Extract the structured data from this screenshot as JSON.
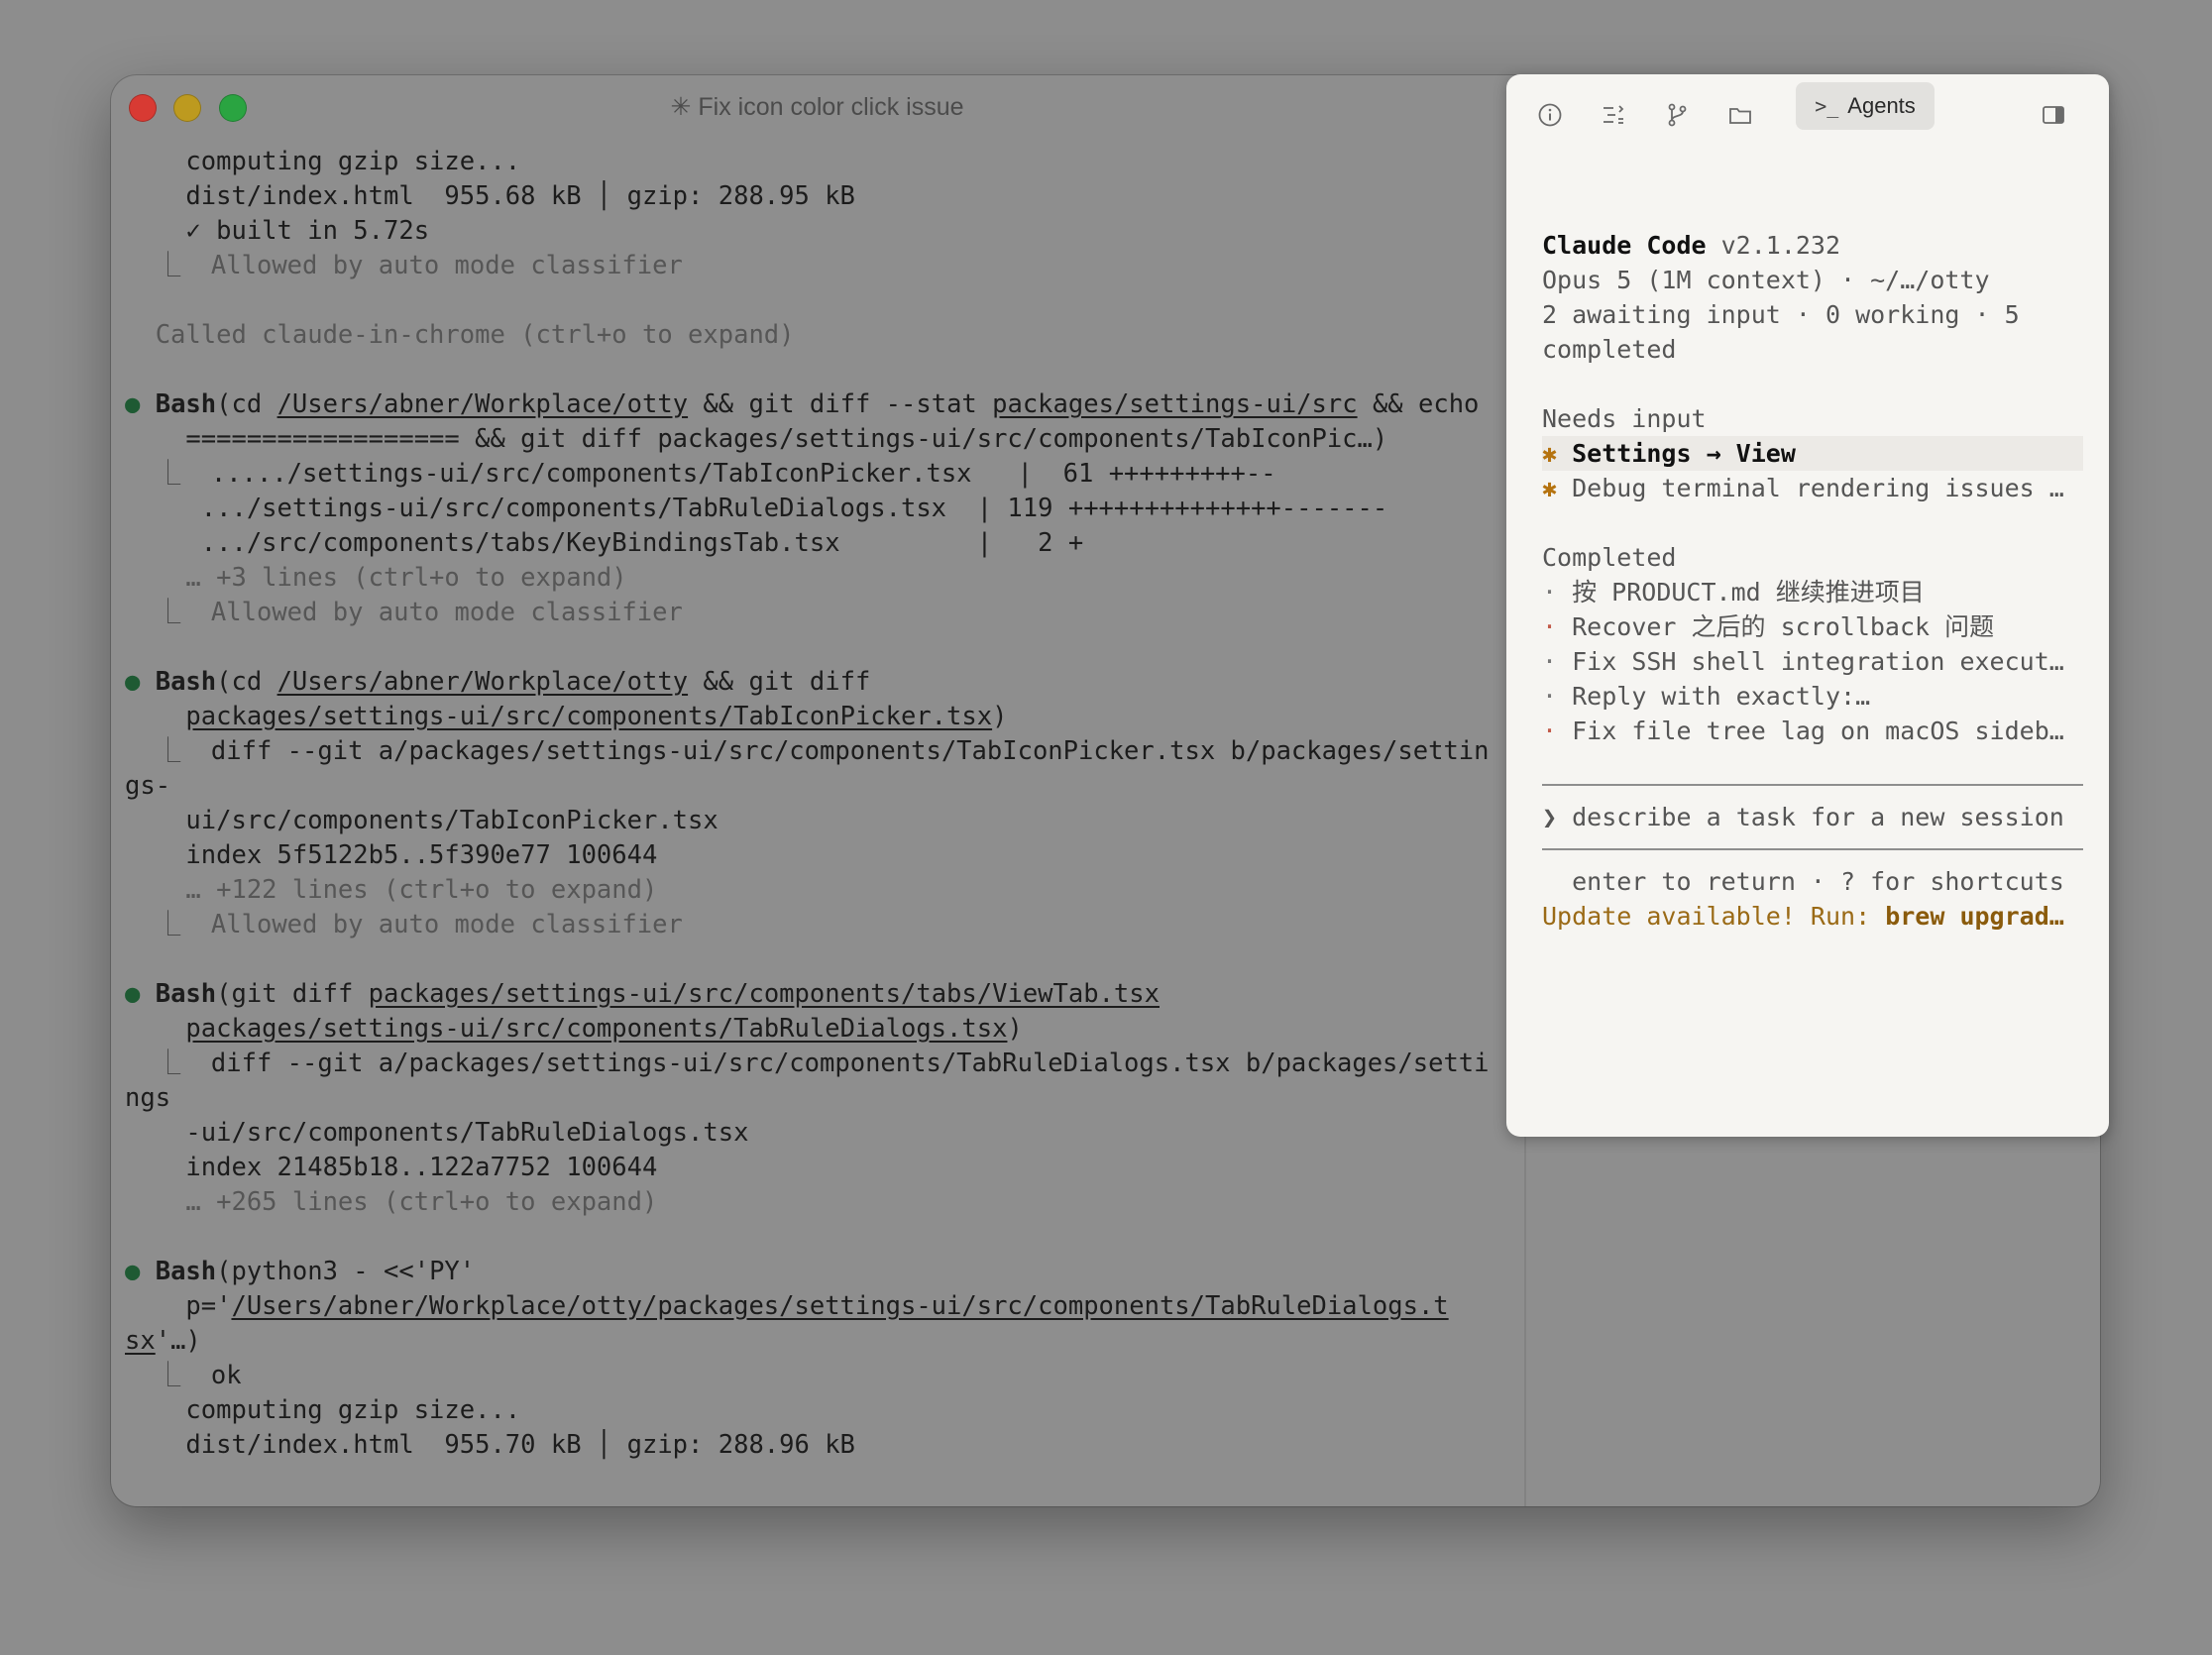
{
  "window": {
    "title": "✳ Fix icon color click issue"
  },
  "terminal": {
    "lines": [
      {
        "k": "out",
        "t": "    computing gzip size..."
      },
      {
        "k": "out",
        "t": "    dist/index.html  955.68 kB │ gzip: 288.95 kB"
      },
      {
        "k": "out",
        "t": "    ✓ built in 5.72s"
      },
      {
        "k": "allow",
        "t": "Allowed by auto mode classifier"
      },
      {
        "k": "blank"
      },
      {
        "k": "info",
        "t": "  Called claude-in-chrome (ctrl+o to expand)"
      },
      {
        "k": "blank"
      },
      {
        "k": "cmd",
        "tool": "Bash",
        "segs": [
          {
            "t": "(cd "
          },
          {
            "t": "/Users/abner/Workplace/otty",
            "u": true
          },
          {
            "t": " && git diff --stat "
          },
          {
            "t": "packages/settings-ui/src",
            "u": true
          },
          {
            "t": " && echo"
          }
        ]
      },
      {
        "k": "cont",
        "t": "    ================== && git diff packages/settings-ui/src/components/TabIconPic…)"
      },
      {
        "k": "res",
        "t": "...../settings-ui/src/components/TabIconPicker.tsx   |  61 +++++++++--"
      },
      {
        "k": "out",
        "t": "     .../settings-ui/src/components/TabRuleDialogs.tsx  | 119 ++++++++++++++-------"
      },
      {
        "k": "out",
        "t": "     .../src/components/tabs/KeyBindingsTab.tsx         |   2 +"
      },
      {
        "k": "dim",
        "t": "    … +3 lines (ctrl+o to expand)"
      },
      {
        "k": "allow",
        "t": "Allowed by auto mode classifier"
      },
      {
        "k": "blank"
      },
      {
        "k": "cmd",
        "tool": "Bash",
        "segs": [
          {
            "t": "(cd "
          },
          {
            "t": "/Users/abner/Workplace/otty",
            "u": true
          },
          {
            "t": " && git diff"
          }
        ]
      },
      {
        "k": "contseg",
        "segs": [
          {
            "t": "    "
          },
          {
            "t": "packages/settings-ui/src/components/TabIconPicker.tsx",
            "u": true
          },
          {
            "t": ")"
          }
        ]
      },
      {
        "k": "res",
        "t": "diff --git a/packages/settings-ui/src/components/TabIconPicker.tsx b/packages/settin"
      },
      {
        "k": "out",
        "t": "gs-"
      },
      {
        "k": "out",
        "t": "    ui/src/components/TabIconPicker.tsx"
      },
      {
        "k": "out",
        "t": "    index 5f5122b5..5f390e77 100644"
      },
      {
        "k": "dim",
        "t": "    … +122 lines (ctrl+o to expand)"
      },
      {
        "k": "allow",
        "t": "Allowed by auto mode classifier"
      },
      {
        "k": "blank"
      },
      {
        "k": "cmd",
        "tool": "Bash",
        "segs": [
          {
            "t": "(git diff "
          },
          {
            "t": "packages/settings-ui/src/components/tabs/ViewTab.tsx",
            "u": true
          }
        ]
      },
      {
        "k": "contseg",
        "segs": [
          {
            "t": "    "
          },
          {
            "t": "packages/settings-ui/src/components/TabRuleDialogs.tsx",
            "u": true
          },
          {
            "t": ")"
          }
        ]
      },
      {
        "k": "res",
        "t": "diff --git a/packages/settings-ui/src/components/TabRuleDialogs.tsx b/packages/setti"
      },
      {
        "k": "out",
        "t": "ngs"
      },
      {
        "k": "out",
        "t": "    -ui/src/components/TabRuleDialogs.tsx"
      },
      {
        "k": "out",
        "t": "    index 21485b18..122a7752 100644"
      },
      {
        "k": "dim",
        "t": "    … +265 lines (ctrl+o to expand)"
      },
      {
        "k": "blank"
      },
      {
        "k": "cmd",
        "tool": "Bash",
        "segs": [
          {
            "t": "(python3 - <<'PY'"
          }
        ]
      },
      {
        "k": "contseg",
        "segs": [
          {
            "t": "    p='"
          },
          {
            "t": "/Users/abner/Workplace/otty/packages/settings-ui/src/components/TabRuleDialogs.t",
            "u": true
          }
        ]
      },
      {
        "k": "contseg",
        "segs": [
          {
            "t": "sx",
            "u": true
          },
          {
            "t": "'…)"
          }
        ]
      },
      {
        "k": "res",
        "t": "ok"
      },
      {
        "k": "out",
        "t": "    computing gzip size..."
      },
      {
        "k": "out",
        "t": "    dist/index.html  955.70 kB │ gzip: 288.96 kB"
      }
    ],
    "allow_prefix": "  ⎿  ",
    "res_prefix": "  ⎿  ",
    "bullet": "●"
  },
  "panel": {
    "toolbar": {
      "agents_label": "Agents",
      "agents_prompt": ">_"
    },
    "header": {
      "name": "Claude Code",
      "version": " v2.1.232",
      "model_line": "Opus 5 (1M context) · ~/…/otty",
      "status_line_1": "2 awaiting input · 0 working · 5",
      "status_line_2": "completed"
    },
    "needs_input": {
      "heading": "Needs input",
      "items": [
        {
          "label": "Settings → View",
          "active": true
        },
        {
          "label": "Debug terminal rendering issues …",
          "active": false
        }
      ]
    },
    "completed": {
      "heading": "Completed",
      "items": [
        {
          "label": "按 PRODUCT.md 继续推进项目",
          "dot": "gray"
        },
        {
          "label": "Recover 之后的 scrollback 问题",
          "dot": "red"
        },
        {
          "label": "Fix SSH shell integration execut…",
          "dot": "gray"
        },
        {
          "label": "Reply with exactly:…",
          "dot": "gray"
        },
        {
          "label": "Fix file tree lag on macOS sideb…",
          "dot": "red"
        }
      ]
    },
    "prompt": {
      "glyph": "❯",
      "placeholder": "describe a task for a new session"
    },
    "footer": {
      "hint": "  enter to return · ? for shortcuts",
      "update_prefix": "Update available! Run: ",
      "update_cmd": "brew upgrad…"
    }
  }
}
